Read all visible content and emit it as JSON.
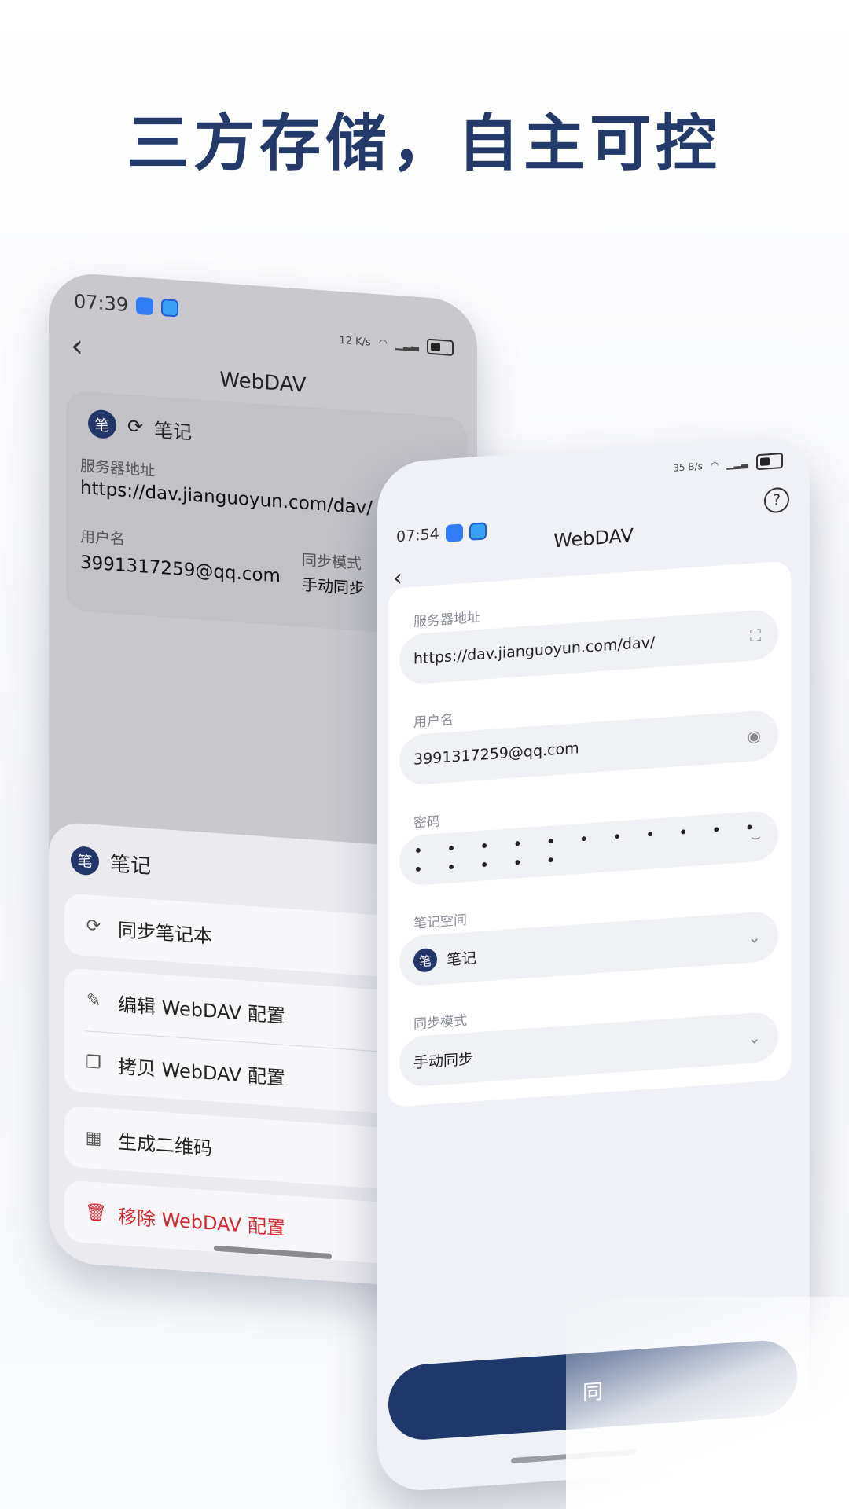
{
  "headline": "三方存储，自主可控",
  "back_phone": {
    "time": "07:39",
    "net_speed": "12 K/s",
    "title": "WebDAV",
    "card": {
      "avatar_char": "笔",
      "space_name": "笔记",
      "server_label": "服务器地址",
      "server_value": "https://dav.jianguoyun.com/dav/",
      "user_label": "用户名",
      "user_value": "3991317259@qq.com",
      "sync_mode_label": "同步模式",
      "sync_mode_value": "手动同步"
    },
    "menu": {
      "avatar_char": "笔",
      "title": "笔记",
      "items": {
        "sync": "同步笔记本",
        "edit": "编辑 WebDAV 配置",
        "copy": "拷贝 WebDAV 配置",
        "qr": "生成二维码",
        "remove": "移除 WebDAV 配置"
      }
    }
  },
  "front_phone": {
    "time": "07:54",
    "net_speed": "35 B/s",
    "title": "WebDAV",
    "help_symbol": "?",
    "fields": {
      "server_label": "服务器地址",
      "server_value": "https://dav.jianguoyun.com/dav/",
      "user_label": "用户名",
      "user_value": "3991317259@qq.com",
      "password_label": "密码",
      "password_value": "• • • • • • • • • • • • • • • •",
      "space_label": "笔记空间",
      "space_avatar": "笔",
      "space_value": "笔记",
      "sync_mode_label": "同步模式",
      "sync_mode_value": "手动同步"
    },
    "button_label": "同"
  },
  "colors": {
    "accent_navy": "#1f376b",
    "danger_red": "#d6262d"
  }
}
